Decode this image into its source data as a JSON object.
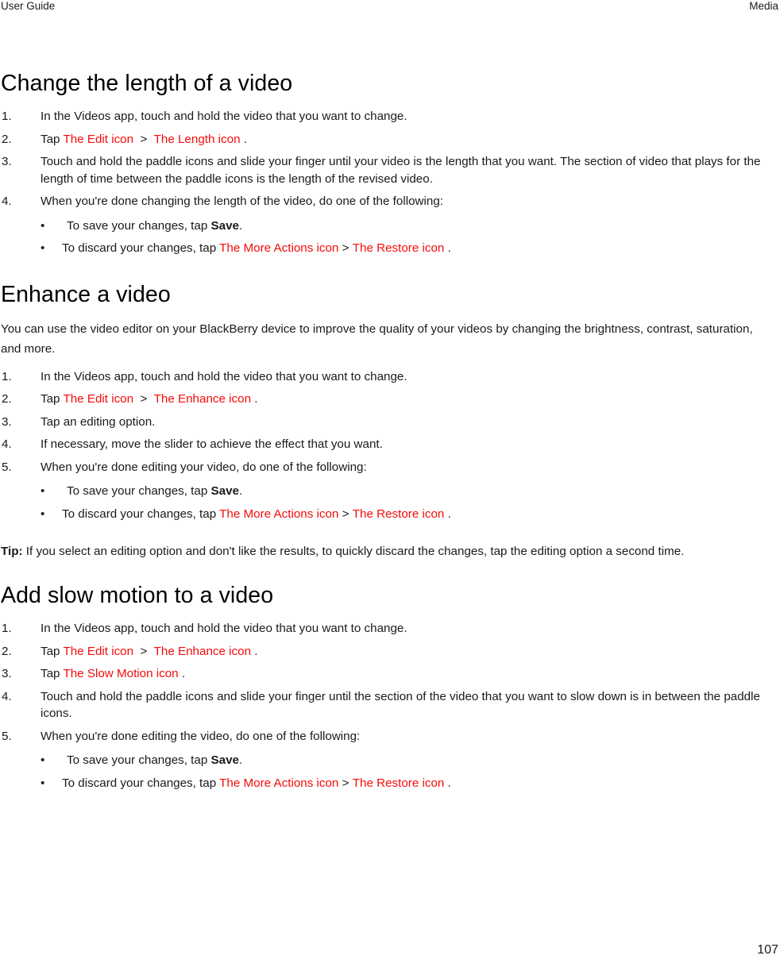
{
  "header": {
    "left": "User Guide",
    "right": "Media"
  },
  "colors": {
    "icon_ref_red": "#f60b0b",
    "text": "#1a1a1a",
    "background": "#ffffff"
  },
  "sections": [
    {
      "title": "Change the length of a video",
      "steps": [
        {
          "num": "1.",
          "text": "In the Videos app, touch and hold the video that you want to change."
        },
        {
          "num": "2.",
          "prefix": "Tap ",
          "icon1": "The Edit icon",
          "sep": ">",
          "icon2": "The Length icon",
          "suffix": "."
        },
        {
          "num": "3.",
          "text": "Touch and hold the paddle icons and slide your finger until your video is the length that you want. The section of video that plays for the length of time between the paddle icons is the length of the revised video."
        },
        {
          "num": "4.",
          "text": "When you're done changing the length of the video, do one of the following:",
          "bullets": [
            {
              "dot": "•",
              "prefix": "To save your changes, tap ",
              "bold": "Save",
              "suffix": "."
            },
            {
              "dot": "•",
              "prefix": "To discard your changes, tap ",
              "icon1": "The More Actions icon",
              "sep": ">",
              "icon2": "The Restore icon",
              "suffix": "."
            }
          ]
        }
      ]
    },
    {
      "title": "Enhance a video",
      "intro": "You can use the video editor on your BlackBerry device to improve the quality of your videos by changing the brightness, contrast, saturation, and more.",
      "steps": [
        {
          "num": "1.",
          "text": "In the Videos app, touch and hold the video that you want to change."
        },
        {
          "num": "2.",
          "prefix": "Tap ",
          "icon1": "The Edit icon",
          "sep": ">",
          "icon2": "The Enhance icon",
          "suffix": "."
        },
        {
          "num": "3.",
          "text": "Tap an editing option."
        },
        {
          "num": "4.",
          "text": "If necessary, move the slider to achieve the effect that you want."
        },
        {
          "num": "5.",
          "text": "When you're done editing your video, do one of the following:",
          "bullets": [
            {
              "dot": "•",
              "prefix": "To save your changes, tap ",
              "bold": "Save",
              "suffix": "."
            },
            {
              "dot": "•",
              "prefix": "To discard your changes, tap ",
              "icon1": "The More Actions icon",
              "sep": ">",
              "icon2": "The Restore icon",
              "suffix": "."
            }
          ]
        }
      ],
      "tip": {
        "label": "Tip:",
        "text": " If you select an editing option and don't like the results, to quickly discard the changes, tap the editing option a second time."
      }
    },
    {
      "title": "Add slow motion to a video",
      "steps": [
        {
          "num": "1.",
          "text": "In the Videos app, touch and hold the video that you want to change."
        },
        {
          "num": "2.",
          "prefix": "Tap ",
          "icon1": "The Edit icon",
          "sep": ">",
          "icon2": "The Enhance icon",
          "suffix": "."
        },
        {
          "num": "3.",
          "prefix": "Tap ",
          "icon1": "The Slow Motion icon",
          "suffix": "."
        },
        {
          "num": "4.",
          "text": "Touch and hold the paddle icons and slide your finger until the section of the video that you want to slow down is in between the paddle icons."
        },
        {
          "num": "5.",
          "text": "When you're done editing the video, do one of the following:",
          "bullets": [
            {
              "dot": "•",
              "prefix": "To save your changes, tap ",
              "bold": "Save",
              "suffix": "."
            },
            {
              "dot": "•",
              "prefix": "To discard your changes, tap ",
              "icon1": "The More Actions icon",
              "sep": ">",
              "icon2": "The Restore icon",
              "suffix": "."
            }
          ]
        }
      ]
    }
  ],
  "footer": {
    "page_number": "107"
  }
}
